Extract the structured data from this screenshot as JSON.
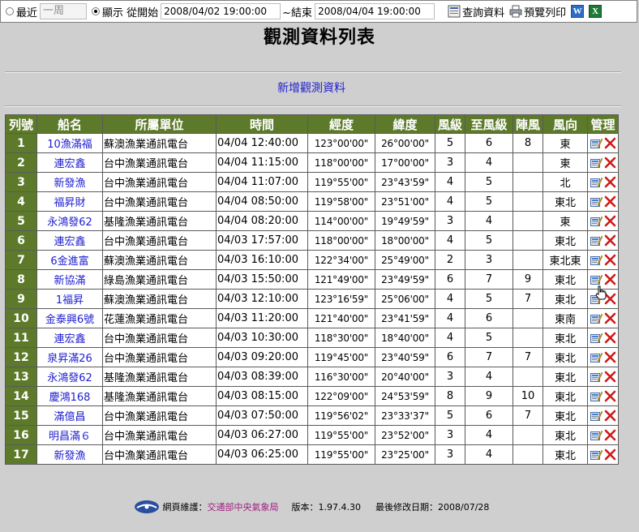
{
  "toolbar": {
    "recent_label": "最近",
    "recent_select": "一周",
    "show_label": "顯示 從開始",
    "start_value": "2008/04/02 19:00:00",
    "end_label": "~結束",
    "end_value": "2008/04/04 19:00:00",
    "query_label": "查詢資料",
    "preview_label": "預覽列印",
    "word_letter": "W",
    "excel_letter": "X"
  },
  "page_title": "觀測資料列表",
  "add_link": "新增觀測資料",
  "columns": [
    "列號",
    "船名",
    "所屬單位",
    "時間",
    "經度",
    "緯度",
    "風級",
    "至風級",
    "陣風",
    "風向",
    "管理"
  ],
  "rows": [
    {
      "no": "1",
      "ship": "10漁滿福",
      "unit": "蘇澳漁業通訊電台",
      "time": "04/04 12:40:00",
      "lon": "123°00'00\"",
      "lat": "26°00'00\"",
      "wind": "5",
      "to_wind": "6",
      "gust": "8",
      "dir": "東"
    },
    {
      "no": "2",
      "ship": "連宏鑫",
      "unit": "台中漁業通訊電台",
      "time": "04/04 11:15:00",
      "lon": "118°00'00\"",
      "lat": "17°00'00\"",
      "wind": "3",
      "to_wind": "4",
      "gust": "",
      "dir": "東"
    },
    {
      "no": "3",
      "ship": "新發漁",
      "unit": "台中漁業通訊電台",
      "time": "04/04 11:07:00",
      "lon": "119°55'00\"",
      "lat": "23°43'59\"",
      "wind": "4",
      "to_wind": "5",
      "gust": "",
      "dir": "北"
    },
    {
      "no": "4",
      "ship": "福昇財",
      "unit": "台中漁業通訊電台",
      "time": "04/04 08:50:00",
      "lon": "119°58'00\"",
      "lat": "23°51'00\"",
      "wind": "4",
      "to_wind": "5",
      "gust": "",
      "dir": "東北"
    },
    {
      "no": "5",
      "ship": "永鴻發62",
      "unit": "基隆漁業通訊電台",
      "time": "04/04 08:20:00",
      "lon": "114°00'00\"",
      "lat": "19°49'59\"",
      "wind": "3",
      "to_wind": "4",
      "gust": "",
      "dir": "東"
    },
    {
      "no": "6",
      "ship": "連宏鑫",
      "unit": "台中漁業通訊電台",
      "time": "04/03 17:57:00",
      "lon": "118°00'00\"",
      "lat": "18°00'00\"",
      "wind": "4",
      "to_wind": "5",
      "gust": "",
      "dir": "東北"
    },
    {
      "no": "7",
      "ship": "6金進富",
      "unit": "蘇澳漁業通訊電台",
      "time": "04/03 16:10:00",
      "lon": "122°34'00\"",
      "lat": "25°49'00\"",
      "wind": "2",
      "to_wind": "3",
      "gust": "",
      "dir": "東北東"
    },
    {
      "no": "8",
      "ship": "新協滿",
      "unit": "綠島漁業通訊電台",
      "time": "04/03 15:50:00",
      "lon": "121°49'00\"",
      "lat": "23°49'59\"",
      "wind": "6",
      "to_wind": "7",
      "gust": "9",
      "dir": "東北"
    },
    {
      "no": "9",
      "ship": "1福昇",
      "unit": "蘇澳漁業通訊電台",
      "time": "04/03 12:10:00",
      "lon": "123°16'59\"",
      "lat": "25°06'00\"",
      "wind": "4",
      "to_wind": "5",
      "gust": "7",
      "dir": "東北"
    },
    {
      "no": "10",
      "ship": "金泰興6號",
      "unit": "花蓮漁業通訊電台",
      "time": "04/03 11:20:00",
      "lon": "121°40'00\"",
      "lat": "23°41'59\"",
      "wind": "4",
      "to_wind": "6",
      "gust": "",
      "dir": "東南"
    },
    {
      "no": "11",
      "ship": "連宏鑫",
      "unit": "台中漁業通訊電台",
      "time": "04/03 10:30:00",
      "lon": "118°30'00\"",
      "lat": "18°40'00\"",
      "wind": "4",
      "to_wind": "5",
      "gust": "",
      "dir": "東北"
    },
    {
      "no": "12",
      "ship": "泉昇滿26",
      "unit": "台中漁業通訊電台",
      "time": "04/03 09:20:00",
      "lon": "119°45'00\"",
      "lat": "23°40'59\"",
      "wind": "6",
      "to_wind": "7",
      "gust": "7",
      "dir": "東北"
    },
    {
      "no": "13",
      "ship": "永鴻發62",
      "unit": "基隆漁業通訊電台",
      "time": "04/03 08:39:00",
      "lon": "116°30'00\"",
      "lat": "20°40'00\"",
      "wind": "3",
      "to_wind": "4",
      "gust": "",
      "dir": "東北"
    },
    {
      "no": "14",
      "ship": "慶鴻168",
      "unit": "基隆漁業通訊電台",
      "time": "04/03 08:15:00",
      "lon": "122°09'00\"",
      "lat": "24°53'59\"",
      "wind": "8",
      "to_wind": "9",
      "gust": "10",
      "dir": "東北"
    },
    {
      "no": "15",
      "ship": "滿億昌",
      "unit": "台中漁業通訊電台",
      "time": "04/03 07:50:00",
      "lon": "119°56'02\"",
      "lat": "23°33'37\"",
      "wind": "5",
      "to_wind": "6",
      "gust": "7",
      "dir": "東北"
    },
    {
      "no": "16",
      "ship": "明昌滿６",
      "unit": "台中漁業通訊電台",
      "time": "04/03 06:27:00",
      "lon": "119°55'00\"",
      "lat": "23°52'00\"",
      "wind": "3",
      "to_wind": "4",
      "gust": "",
      "dir": "東北"
    },
    {
      "no": "17",
      "ship": "新發漁",
      "unit": "台中漁業通訊電台",
      "time": "04/03 06:25:00",
      "lon": "119°55'00\"",
      "lat": "23°25'00\"",
      "wind": "3",
      "to_wind": "4",
      "gust": "",
      "dir": "東北"
    }
  ],
  "footer": {
    "maintain_label": "網頁維護：",
    "agency": "交通部中央氣象局",
    "version": "版本：1.97.4.30",
    "modified": "最後修改日期：2008/07/28"
  },
  "colors": {
    "header_bg": "#5d7a2a",
    "link": "#2020d0",
    "delete": "#d01818",
    "agency": "#a02080"
  }
}
